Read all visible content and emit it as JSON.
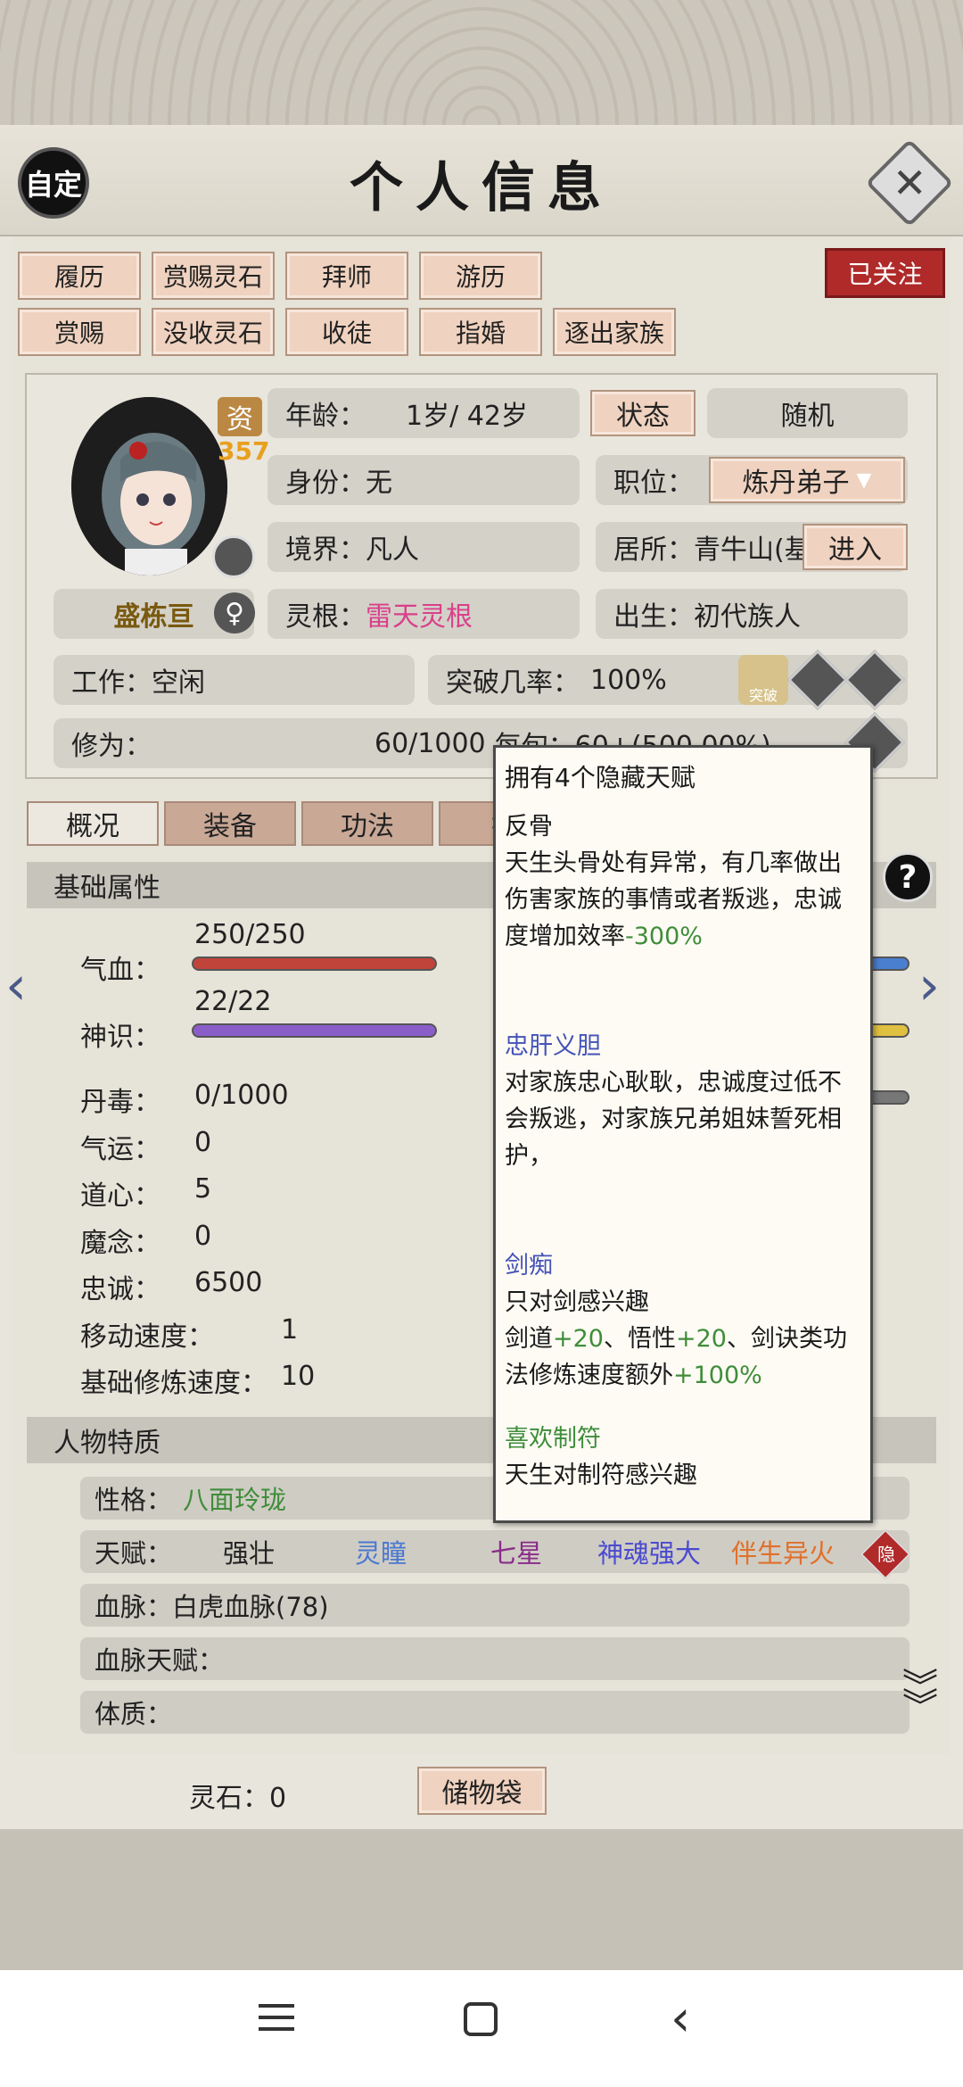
{
  "header": {
    "title": "个人信息",
    "auto_label": "自定",
    "close": "✕"
  },
  "actions_row1": [
    "履历",
    "赏赐灵石",
    "拜师",
    "游历"
  ],
  "actions_row2": [
    "赏赐",
    "没收灵石",
    "收徒",
    "指婚",
    "逐出家族"
  ],
  "follow_label": "已关注",
  "character": {
    "name": "盛栋亘",
    "talent_badge": "资",
    "talent_value": "357",
    "age_label": "年龄：",
    "age_value": "1岁/ 42岁",
    "status_button": "状态",
    "random_button": "随机",
    "identity_label": "身份：",
    "identity_value": "无",
    "position_label": "职位：",
    "position_value": "炼丹弟子",
    "realm_label": "境界：",
    "realm_value": "凡人",
    "residence_label": "居所：",
    "residence_value": "青牛山(基",
    "enter_button": "进入",
    "root_label": "灵根：",
    "root_value": "雷天灵根",
    "birth_label": "出生：",
    "birth_value": "初代族人",
    "work_label": "工作：",
    "work_value": "空闲",
    "breakthrough_label": "突破几率：",
    "breakthrough_value": "100%",
    "breakthrough_icon_text": "突破",
    "cultivation_label": "修为：",
    "cultivation_value": "60/1000",
    "cultivation_rate": "每旬：60+(500.00%)"
  },
  "tabs": [
    "概况",
    "装备",
    "功法",
    "技"
  ],
  "basic": {
    "title": "基础属性",
    "hp_label": "气血：",
    "hp_value": "250/250",
    "sense_label": "神识：",
    "sense_value": "22/22",
    "stats": [
      {
        "label": "丹毒：",
        "value": "0/1000"
      },
      {
        "label": "气运：",
        "value": "0"
      },
      {
        "label": "道心：",
        "value": "5"
      },
      {
        "label": "魔念：",
        "value": "0"
      },
      {
        "label": "忠诚：",
        "value": "6500"
      },
      {
        "label": "移动速度：",
        "value": "1"
      },
      {
        "label": "基础修炼速度：",
        "value": "10"
      }
    ]
  },
  "traits": {
    "title": "人物特质",
    "personality_label": "性格：",
    "personality_value": "八面玲珑",
    "talent_label": "天赋：",
    "talents": [
      "强壮",
      "灵瞳",
      "七星",
      "神魂强大",
      "伴生异火"
    ],
    "hidden_badge": "隐",
    "bloodline_label": "血脉：",
    "bloodline_value": "白虎血脉(78)",
    "bloodline_talent_label": "血脉天赋：",
    "physique_label": "体质："
  },
  "footer": {
    "spirit_stone": "灵石：0",
    "storage_button": "储物袋"
  },
  "popup": {
    "title": "拥有4个隐藏天赋",
    "items": [
      {
        "name": "反骨",
        "desc": "天生头骨处有异常，有几率做出伤害家族的事情或者叛逃，忠诚度增加效率",
        "extra": "-300%"
      },
      {
        "name": "忠肝义胆",
        "desc": "对家族忠心耿耿，忠诚度过低不会叛逃，对家族兄弟姐妹誓死相护，"
      },
      {
        "name": "剑痴",
        "desc": "只对剑感兴趣",
        "line2_a": "剑道",
        "line2_b": "+20",
        "line2_c": "、悟性",
        "line2_d": "+20",
        "line2_e": "、剑诀类功法修炼速度额外",
        "line2_f": "+100%"
      },
      {
        "name": "喜欢制符",
        "desc": "天生对制符感兴趣"
      }
    ]
  },
  "colors": {
    "hp_bar": "#c0443a",
    "sense_bar": "#8a5ec8",
    "root_text": "#d9408a",
    "personality_text": "#3f8d3a",
    "follow_bg": "#b02a2a"
  },
  "icons": [
    "question-icon",
    "double-chevron-down-icon",
    "arrow-left-icon",
    "arrow-right-icon",
    "female-icon",
    "plus-icon",
    "play-icon",
    "dropdown-icon"
  ]
}
